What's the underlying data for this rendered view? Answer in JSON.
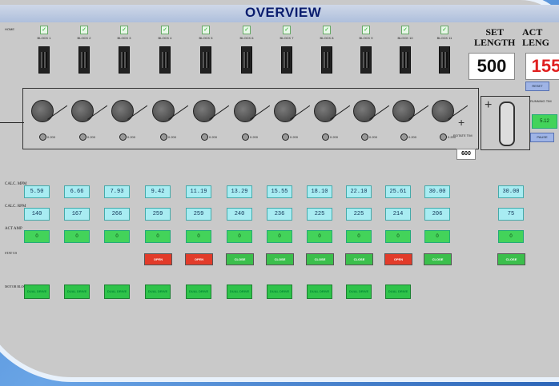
{
  "window": {
    "title": "OVERVIEW",
    "corner_label": "HOME"
  },
  "blocks": [
    {
      "label": "BLOCK 1",
      "status": "✓"
    },
    {
      "label": "BLOCK 2",
      "status": "✓"
    },
    {
      "label": "BLOCK 3",
      "status": "✓"
    },
    {
      "label": "BLOCK 4",
      "status": "✓"
    },
    {
      "label": "BLOCK 5",
      "status": "✓"
    },
    {
      "label": "BLOCK 6",
      "status": "✓"
    },
    {
      "label": "BLOCK 7",
      "status": "✓"
    },
    {
      "label": "BLOCK 8",
      "status": "✓"
    },
    {
      "label": "BLOCK 9",
      "status": "✓"
    },
    {
      "label": "BLOCK 10",
      "status": "✓"
    },
    {
      "label": "BLOCK 11",
      "status": "✓"
    }
  ],
  "set_length": {
    "label_line1": "SET",
    "label_line2": "LENGTH",
    "value": "500"
  },
  "actual_length": {
    "label_line1": "ACT",
    "label_line2": "LENG",
    "value": "155"
  },
  "reset_button": "RESET",
  "pause_button": "PAUSE",
  "running_time": {
    "label": "RUNNING TIM",
    "value": "5.12"
  },
  "rollers": {
    "speed_labels": [
      "0.200",
      "0.200",
      "0.200",
      "0.200",
      "0.200",
      "0.200",
      "0.200",
      "0.200",
      "0.200",
      "0.200",
      "0.200"
    ],
    "rotate_label": "ROTATE TIM",
    "rotate_value": "600"
  },
  "rows": {
    "calc_mpm_label": "CALC. MPM",
    "calc_rpm_label": "CALC. RPM",
    "act_amp_label": "ACT AMP",
    "status_label": "STAT US",
    "dual_label": "MOTOR BLOCK"
  },
  "calc_mpm": [
    "5.50",
    "6.66",
    "7.93",
    "9.42",
    "11.19",
    "13.29",
    "15.55",
    "18.10",
    "22.10",
    "25.61",
    "30.00"
  ],
  "calc_mpm_extra": "30.00",
  "calc_rpm": [
    "140",
    "167",
    "266",
    "259",
    "259",
    "240",
    "236",
    "225",
    "225",
    "214",
    "206"
  ],
  "calc_rpm_extra": "75",
  "act_amp": [
    "0",
    "0",
    "0",
    "0",
    "0",
    "0",
    "0",
    "0",
    "0",
    "0",
    "0"
  ],
  "act_amp_extra": "0",
  "status": [
    null,
    null,
    null,
    {
      "t": "OPEN",
      "c": "red"
    },
    {
      "t": "OPEN",
      "c": "red"
    },
    {
      "t": "CLOSE",
      "c": "grn"
    },
    {
      "t": "CLOSE",
      "c": "grn"
    },
    {
      "t": "CLOSE",
      "c": "grn"
    },
    {
      "t": "CLOSE",
      "c": "grn"
    },
    {
      "t": "OPEN",
      "c": "red"
    },
    {
      "t": "CLOSE",
      "c": "grn"
    }
  ],
  "status_extra": "CLOSE",
  "dual": [
    "DUAL DRIVE",
    "DUAL DRIVE",
    "DUAL DRIVE",
    "DUAL DRIVE",
    "DUAL DRIVE",
    "DUAL DRIVE",
    "DUAL DRIVE",
    "DUAL DRIVE",
    "DUAL DRIVE",
    "DUAL DRIVE"
  ]
}
